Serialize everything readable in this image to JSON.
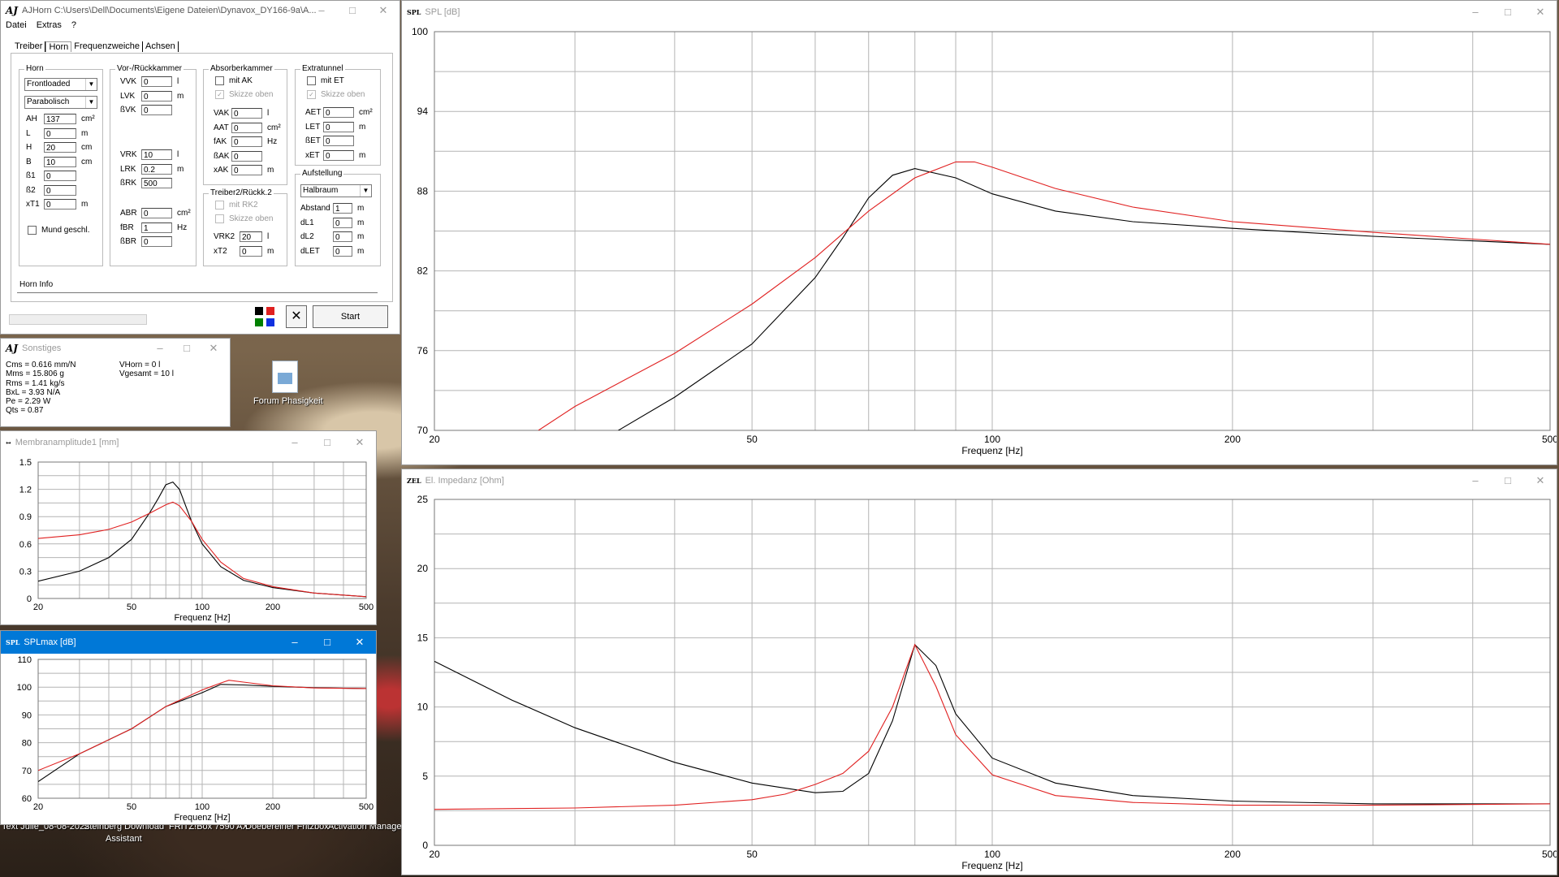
{
  "desktop": {
    "icon_label": "Forum Phasigkeit",
    "taskbar_items": [
      "Text Julie_08-08-2022",
      "Steinberg Download",
      "FRITZ!Box 7590 AX",
      "Doebereiner Fritzbox",
      "Activation Manager"
    ],
    "taskbar_sub": "Assistant"
  },
  "main_window": {
    "title": "AJHorn  C:\\Users\\Dell\\Documents\\Eigene Dateien\\Dynavox_DY166-9a\\A...",
    "menu": [
      "Datei",
      "Extras",
      "?"
    ],
    "tabs": [
      "Treiber",
      "Horn",
      "Frequenzweiche",
      "Achsen"
    ],
    "selected_tab": "Horn",
    "horn": {
      "label": "Horn",
      "type_select": "Frontloaded",
      "profile_select": "Parabolisch",
      "fields": [
        {
          "label": "AH",
          "value": "137",
          "unit": "cm²"
        },
        {
          "label": "L",
          "value": "0",
          "unit": "m"
        },
        {
          "label": "H",
          "value": "20",
          "unit": "cm"
        },
        {
          "label": "B",
          "value": "10",
          "unit": "cm"
        },
        {
          "label": "ß1",
          "value": "0",
          "unit": ""
        },
        {
          "label": "ß2",
          "value": "0",
          "unit": ""
        },
        {
          "label": "xT1",
          "value": "0",
          "unit": "m"
        }
      ],
      "mouth_closed": "Mund geschl."
    },
    "chamber": {
      "label": "Vor-/Rückkammer",
      "top": [
        {
          "label": "VVK",
          "value": "0",
          "unit": "l"
        },
        {
          "label": "LVK",
          "value": "0",
          "unit": "m"
        },
        {
          "label": "ßVK",
          "value": "0",
          "unit": ""
        }
      ],
      "mid": [
        {
          "label": "VRK",
          "value": "10",
          "unit": "l"
        },
        {
          "label": "LRK",
          "value": "0.2",
          "unit": "m"
        },
        {
          "label": "ßRK",
          "value": "500",
          "unit": ""
        }
      ],
      "bottom": [
        {
          "label": "ABR",
          "value": "0",
          "unit": "cm²"
        },
        {
          "label": "fBR",
          "value": "1",
          "unit": "Hz"
        },
        {
          "label": "ßBR",
          "value": "0",
          "unit": ""
        }
      ]
    },
    "absorber": {
      "label": "Absorberkammer",
      "check1": "mit AK",
      "check2": "Skizze oben",
      "fields": [
        {
          "label": "VAK",
          "value": "0",
          "unit": "l"
        },
        {
          "label": "AAT",
          "value": "0",
          "unit": "cm²"
        },
        {
          "label": "fAK",
          "value": "0",
          "unit": "Hz"
        },
        {
          "label": "ßAK",
          "value": "0",
          "unit": ""
        },
        {
          "label": "xAK",
          "value": "0",
          "unit": "m"
        }
      ]
    },
    "driver2": {
      "label": "Treiber2/Rückk.2",
      "check1": "mit RK2",
      "check2": "Skizze oben",
      "fields": [
        {
          "label": "VRK2",
          "value": "20",
          "unit": "l"
        },
        {
          "label": "xT2",
          "value": "0",
          "unit": "m"
        }
      ]
    },
    "extratunnel": {
      "label": "Extratunnel",
      "check1": "mit ET",
      "check2": "Skizze oben",
      "fields": [
        {
          "label": "AET",
          "value": "0",
          "unit": "cm²"
        },
        {
          "label": "LET",
          "value": "0",
          "unit": "m"
        },
        {
          "label": "ßET",
          "value": "0",
          "unit": ""
        },
        {
          "label": "xET",
          "value": "0",
          "unit": "m"
        }
      ]
    },
    "placement": {
      "label": "Aufstellung",
      "select": "Halbraum",
      "fields": [
        {
          "label": "Abstand",
          "value": "1",
          "unit": "m"
        },
        {
          "label": "dL1",
          "value": "0",
          "unit": "m"
        },
        {
          "label": "dL2",
          "value": "0",
          "unit": "m"
        },
        {
          "label": "dLET",
          "value": "0",
          "unit": "m"
        }
      ]
    },
    "horn_info": "Horn Info",
    "start_label": "Start",
    "colors": [
      "#000000",
      "#e02020",
      "#008000",
      "#1030e0"
    ]
  },
  "sonstiges": {
    "title": "Sonstiges",
    "left": [
      "Cms = 0.616 mm/N",
      "Mms = 15.806 g",
      "Rms = 1.41 kg/s",
      "BxL = 3.93 N/A",
      "Pe = 2.29 W",
      "Qts = 0.87"
    ],
    "right": [
      "VHorn = 0 l",
      "Vgesamt = 10 l"
    ]
  },
  "chart_data": [
    {
      "id": "spl",
      "type": "line",
      "window_title": "SPL [dB]",
      "icon_text": "SPL",
      "xlabel": "Frequenz [Hz]",
      "xscale": "log",
      "xlim": [
        20,
        500
      ],
      "x_ticks": [
        20,
        50,
        100,
        200,
        500
      ],
      "ylim": [
        70,
        100
      ],
      "y_ticks": [
        70,
        76,
        82,
        88,
        94,
        100
      ],
      "series": [
        {
          "color": "#000000",
          "x": [
            34,
            40,
            50,
            60,
            65,
            70,
            75,
            80,
            90,
            100,
            120,
            150,
            200,
            300,
            500
          ],
          "y": [
            70,
            72.5,
            76.5,
            81.5,
            84.5,
            87.5,
            89.2,
            89.7,
            89,
            87.8,
            86.5,
            85.7,
            85.2,
            84.6,
            84
          ]
        },
        {
          "color": "#e02020",
          "x": [
            27,
            30,
            40,
            50,
            60,
            70,
            80,
            90,
            95,
            100,
            120,
            150,
            200,
            300,
            500
          ],
          "y": [
            70,
            71.8,
            75.8,
            79.5,
            83,
            86.5,
            89,
            90.2,
            90.2,
            89.8,
            88.2,
            86.8,
            85.7,
            84.9,
            84
          ]
        }
      ]
    },
    {
      "id": "impedance",
      "type": "line",
      "window_title": "El. Impedanz [Ohm]",
      "icon_text": "ZEL",
      "xlabel": "Frequenz [Hz]",
      "xscale": "log",
      "xlim": [
        20,
        500
      ],
      "x_ticks": [
        20,
        50,
        100,
        200,
        500
      ],
      "ylim": [
        0,
        25
      ],
      "y_ticks": [
        0,
        5,
        10,
        15,
        20,
        25
      ],
      "series": [
        {
          "color": "#000000",
          "x": [
            20,
            25,
            30,
            40,
            50,
            60,
            65,
            70,
            75,
            80,
            85,
            90,
            100,
            120,
            150,
            200,
            300,
            500
          ],
          "y": [
            13.3,
            10.5,
            8.5,
            6,
            4.5,
            3.8,
            3.9,
            5.2,
            9,
            14.5,
            13,
            9.5,
            6.3,
            4.5,
            3.6,
            3.2,
            3,
            3
          ]
        },
        {
          "color": "#e02020",
          "x": [
            20,
            30,
            40,
            50,
            55,
            60,
            65,
            70,
            75,
            80,
            85,
            90,
            100,
            120,
            150,
            200,
            300,
            500
          ],
          "y": [
            2.6,
            2.7,
            2.9,
            3.3,
            3.7,
            4.4,
            5.2,
            6.8,
            10,
            14.5,
            11.5,
            8,
            5.1,
            3.6,
            3.1,
            2.9,
            2.9,
            3
          ]
        }
      ]
    },
    {
      "id": "amplitude",
      "type": "line",
      "window_title": "Membranamplitude1 [mm]",
      "icon_text": "↔",
      "xlabel": "Frequenz [Hz]",
      "xscale": "log",
      "xlim": [
        20,
        500
      ],
      "x_ticks": [
        20,
        50,
        100,
        200,
        500
      ],
      "ylim": [
        0,
        1.5
      ],
      "y_ticks": [
        0,
        0.3,
        0.6,
        0.9,
        1.2,
        1.5
      ],
      "series": [
        {
          "color": "#000000",
          "x": [
            20,
            30,
            40,
            50,
            60,
            65,
            70,
            75,
            80,
            90,
            100,
            120,
            150,
            200,
            300,
            500
          ],
          "y": [
            0.19,
            0.3,
            0.45,
            0.65,
            0.95,
            1.1,
            1.25,
            1.28,
            1.2,
            0.85,
            0.6,
            0.35,
            0.2,
            0.12,
            0.06,
            0.02
          ]
        },
        {
          "color": "#e02020",
          "x": [
            20,
            30,
            40,
            50,
            60,
            70,
            75,
            80,
            90,
            100,
            120,
            150,
            200,
            300,
            500
          ],
          "y": [
            0.66,
            0.7,
            0.76,
            0.84,
            0.94,
            1.03,
            1.06,
            1.02,
            0.85,
            0.65,
            0.4,
            0.22,
            0.13,
            0.06,
            0.02
          ]
        }
      ]
    },
    {
      "id": "splmax",
      "type": "line",
      "window_title": "SPLmax [dB]",
      "icon_text": "SPL",
      "xlabel": "Frequenz [Hz]",
      "xscale": "log",
      "xlim": [
        20,
        500
      ],
      "x_ticks": [
        20,
        50,
        100,
        200,
        500
      ],
      "ylim": [
        60,
        110
      ],
      "y_ticks": [
        60,
        70,
        80,
        90,
        100,
        110
      ],
      "series": [
        {
          "color": "#000000",
          "x": [
            20,
            30,
            50,
            70,
            100,
            120,
            150,
            200,
            300,
            500
          ],
          "y": [
            66,
            76,
            85,
            93,
            98,
            101,
            100.8,
            100.3,
            99.8,
            99.5
          ]
        },
        {
          "color": "#e02020",
          "x": [
            20,
            30,
            50,
            70,
            100,
            120,
            130,
            150,
            200,
            300,
            500
          ],
          "y": [
            70,
            76,
            85,
            93,
            99,
            101.5,
            102.5,
            101.8,
            100.5,
            99.7,
            99.5
          ]
        }
      ]
    }
  ]
}
